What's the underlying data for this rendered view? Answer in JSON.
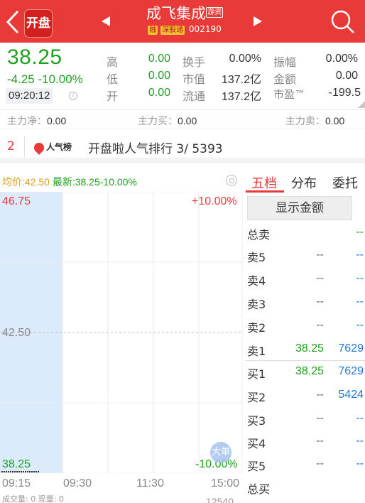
{
  "header": {
    "logo_text": "开盘",
    "stock_name": "成飞集成",
    "tag_youzi": "游资",
    "tag_rong": "融",
    "tag_sgt": "深股通",
    "stock_code": "002190"
  },
  "quote": {
    "price": "38.25",
    "change": "-4.25",
    "change_pct": "-10.00%",
    "time": "09:20:12",
    "info_icon": "ⓘ",
    "labels": [
      "高",
      "低",
      "开"
    ],
    "values": [
      "0.00",
      "0.00",
      "0.00"
    ],
    "mid_labels": [
      "换手",
      "市值",
      "流通"
    ],
    "mid_values": [
      "0.00%",
      "137.2亿",
      "137.2亿"
    ],
    "right_labels": [
      "振幅",
      "金额",
      "市盈™"
    ],
    "right_values": [
      "0.00%",
      "0.00",
      "-199.5"
    ]
  },
  "main_force": {
    "net_label": "主力净：",
    "net_value": "0.00",
    "buy_label": "主力买：",
    "buy_value": "0.00",
    "sell_label": "主力卖：",
    "sell_value": "0.00"
  },
  "popularity": {
    "index": "2",
    "logo_label": "人气榜",
    "text": "开盘啦人气排行 3/ 5393"
  },
  "chart_header": {
    "avg_label": "均价:42.50",
    "latest_label": "最新:38.25",
    "latest_pct": "-10.00%"
  },
  "chart_data": {
    "type": "line",
    "y_left_ticks": [
      "46.75",
      "42.50",
      "38.25"
    ],
    "y_right_ticks": [
      "+10.00%",
      "-10.00%"
    ],
    "x_ticks": [
      "09:15",
      "09:30",
      "11:30",
      "15:00"
    ],
    "ylim": [
      38.25,
      46.75
    ],
    "prev_close": 42.5,
    "grid": true
  },
  "chart_footer": {
    "vol_label": "成交量: 0 现量: 0",
    "vol_right": "12540",
    "big_order_label": "大单"
  },
  "order_book": {
    "tabs": [
      "五档",
      "分布",
      "委托"
    ],
    "show_amount": "显示金额",
    "total_sell_label": "总卖",
    "total_sell_value": "--",
    "sells": [
      {
        "label": "卖5",
        "price": "--",
        "vol": "--"
      },
      {
        "label": "卖4",
        "price": "--",
        "vol": "--"
      },
      {
        "label": "卖3",
        "price": "--",
        "vol": "--"
      },
      {
        "label": "卖2",
        "price": "--",
        "vol": "--"
      },
      {
        "label": "卖1",
        "price": "38.25",
        "vol": "7629"
      }
    ],
    "buys": [
      {
        "label": "买1",
        "price": "38.25",
        "vol": "7629"
      },
      {
        "label": "买2",
        "price": "--",
        "vol": "5424"
      },
      {
        "label": "买3",
        "price": "--",
        "vol": "--"
      },
      {
        "label": "买4",
        "price": "--",
        "vol": "--"
      },
      {
        "label": "买5",
        "price": "--",
        "vol": "--"
      }
    ],
    "total_buy_label": "总买"
  },
  "colors": {
    "brand_red": "#e83a38",
    "down_green": "#1fa01f",
    "avg_yellow": "#e0a020",
    "blue": "#2277dd"
  }
}
